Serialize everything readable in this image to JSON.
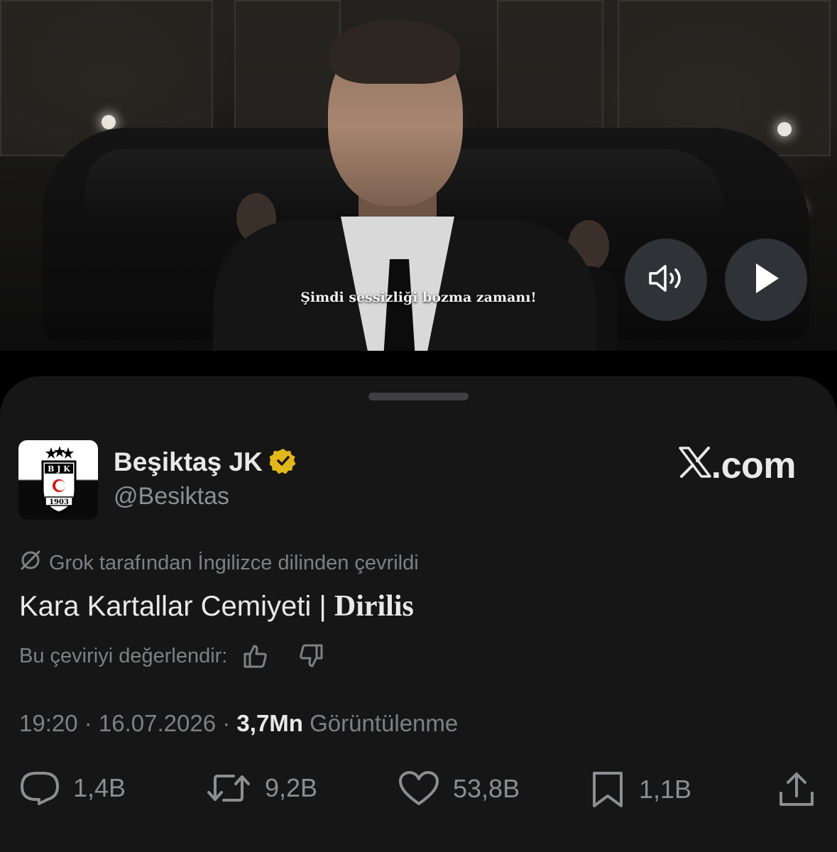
{
  "video": {
    "subtitle": "Şimdi sessizliği bozma zamanı!",
    "controls": {
      "mute_icon": "speaker-icon",
      "play_icon": "play-icon"
    }
  },
  "author": {
    "name": "Beşiktaş JK",
    "handle": "@Besiktas",
    "verified_icon": "verified-badge-icon",
    "verified_color": "#e2b719",
    "avatar_text": "BJK 1903"
  },
  "source": {
    "label": ".com",
    "logo_icon": "x-logo-icon"
  },
  "translation": {
    "notice": "Grok tarafından İngilizce dilinden çevrildi",
    "icon": "translate-icon"
  },
  "tweet": {
    "text_main": "Kara Kartallar Cemiyeti | ",
    "text_strong": "Dirilis"
  },
  "rating": {
    "prompt": "Bu çeviriyi değerlendir:",
    "up_icon": "thumbs-up-icon",
    "down_icon": "thumbs-down-icon"
  },
  "meta": {
    "time": "19:20",
    "sep1": " · ",
    "date": "16.07.2026",
    "sep2": " · ",
    "views_count": "3,7Mn",
    "views_label": " Görüntülenme"
  },
  "actions": {
    "replies": {
      "count": "1,4B",
      "icon": "reply-icon"
    },
    "reposts": {
      "count": "9,2B",
      "icon": "repost-icon"
    },
    "likes": {
      "count": "53,8B",
      "icon": "heart-icon"
    },
    "bookmarks": {
      "count": "1,1B",
      "icon": "bookmark-icon"
    },
    "share": {
      "icon": "share-icon"
    }
  },
  "colors": {
    "sheet_bg": "#161616",
    "text": "#e9e9e9",
    "muted": "#7d8186"
  }
}
